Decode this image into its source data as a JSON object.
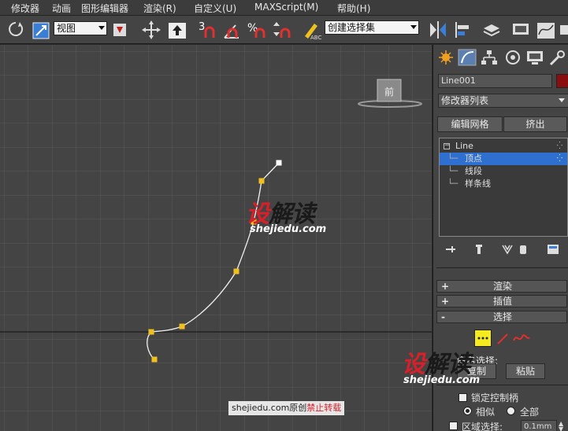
{
  "menu": [
    "修改器",
    "动画",
    "图形编辑器",
    "渲染(R)",
    "自定义(U)",
    "MAXScript(M)",
    "帮助(H)"
  ],
  "toolbar": {
    "ref_coord_value": "视图",
    "snap_3_label": "3",
    "named_selection_value": "创建选择集",
    "abc_label": "ABC"
  },
  "viewport": {
    "viewcube_label": "前"
  },
  "panel": {
    "object_name": "Line001",
    "object_color": "#8b0e0e",
    "modifier_list": "修改器列表",
    "edit_mesh_button": "编辑网格",
    "extrude_button": "挤出",
    "stack": {
      "root": "Line",
      "items": [
        "顶点",
        "线段",
        "样条线"
      ]
    },
    "rollouts": {
      "render": "渲染",
      "interpolation": "插值",
      "selection": "选择"
    },
    "named_sel_label": "命名选择:",
    "copy_button": "复制",
    "paste_button": "粘贴",
    "lock_handles": "锁定控制柄",
    "similar": "相似",
    "all": "全部",
    "area_select": "区域选择:",
    "area_value": "0.1mm"
  },
  "watermark": {
    "logo_red": "设",
    "logo_dark": "解读",
    "url": "shejiedu.com",
    "credit_main": "shejiedu.com原创",
    "credit_red": "禁止转载"
  },
  "colors": {
    "vertex": "#f0c020",
    "vertex_selected": "#ffffff",
    "selection_highlight": "#2f6fd0"
  }
}
